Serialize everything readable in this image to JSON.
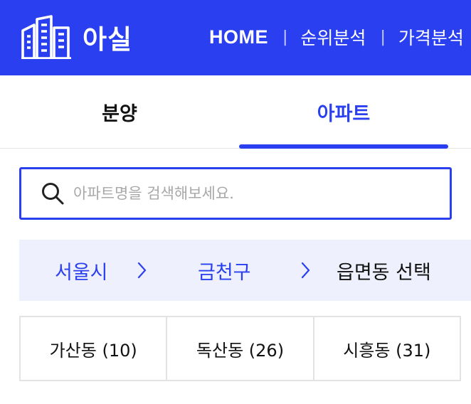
{
  "header": {
    "logo_text": "아실",
    "nav": [
      "HOME",
      "순위분석",
      "가격분석"
    ],
    "background_color": "#2a40f0"
  },
  "tabs": [
    {
      "label": "분양",
      "active": false
    },
    {
      "label": "아파트",
      "active": true
    }
  ],
  "search": {
    "placeholder": "아파트명을 검색해보세요.",
    "value": "",
    "icon": "search-icon"
  },
  "breadcrumb": {
    "city": "서울시",
    "district": "금천구",
    "dong_select": "읍면동 선택",
    "separator_icon": "chevron-right-icon"
  },
  "dongs": [
    {
      "label": "가산동 (10)"
    },
    {
      "label": "독산동 (26)"
    },
    {
      "label": "시흥동 (31)"
    }
  ],
  "colors": {
    "accent": "#2a40f0",
    "breadcrumb_bg": "#eef0fd"
  }
}
